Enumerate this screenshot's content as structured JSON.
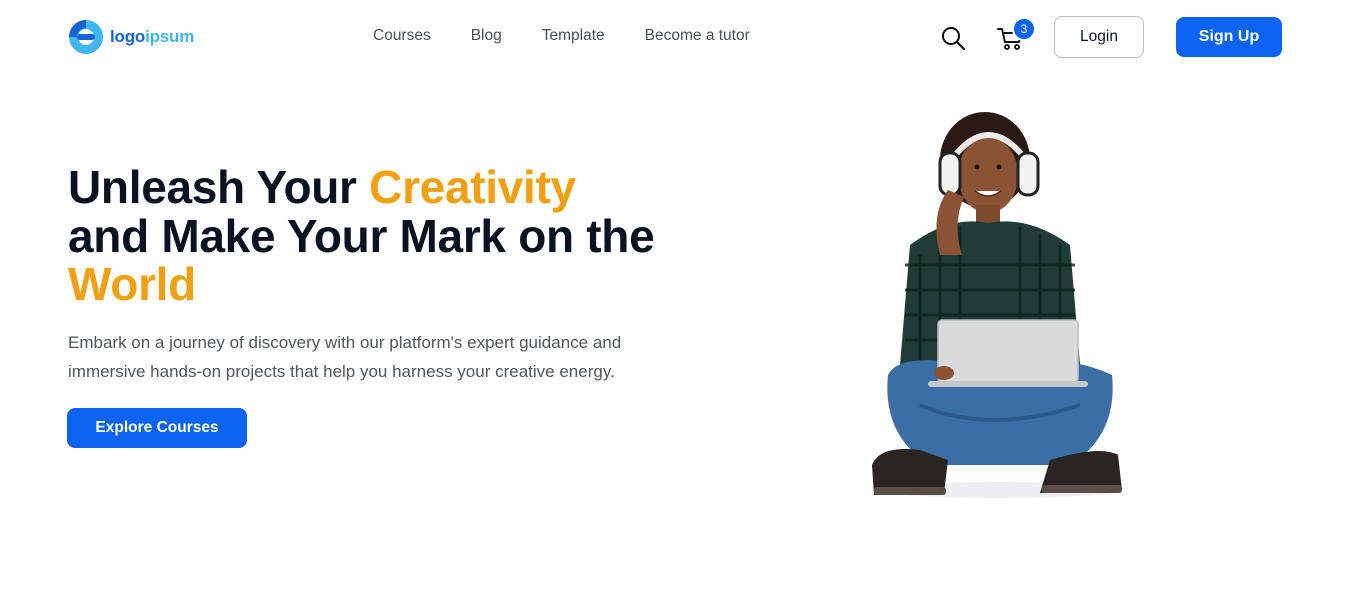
{
  "logo": {
    "part1": "logo",
    "part2": "ipsum",
    "colors": {
      "primary": "#1562d6",
      "secondary": "#3fb6ee"
    }
  },
  "nav": {
    "items": [
      "Courses",
      "Blog",
      "Template",
      "Become a tutor"
    ]
  },
  "header": {
    "search_icon": "search-icon",
    "cart_icon": "cart-icon",
    "cart_count": "3",
    "login_label": "Login",
    "signup_label": "Sign Up"
  },
  "hero": {
    "title_part1": "Unleash Your ",
    "title_accent1": "Creativity",
    "title_part2": " and Make Your Mark on the ",
    "title_accent2": "World",
    "subtitle": "Embark on a journey of discovery with our platform's expert guidance and immersive hands-on projects that help you harness your creative energy.",
    "cta_label": "Explore Courses",
    "image": "student-with-laptop-and-headphones"
  },
  "colors": {
    "brand": "#0b63f0",
    "accent": "#f0a012",
    "heading": "#0b1221",
    "body_text": "#4f555e"
  }
}
